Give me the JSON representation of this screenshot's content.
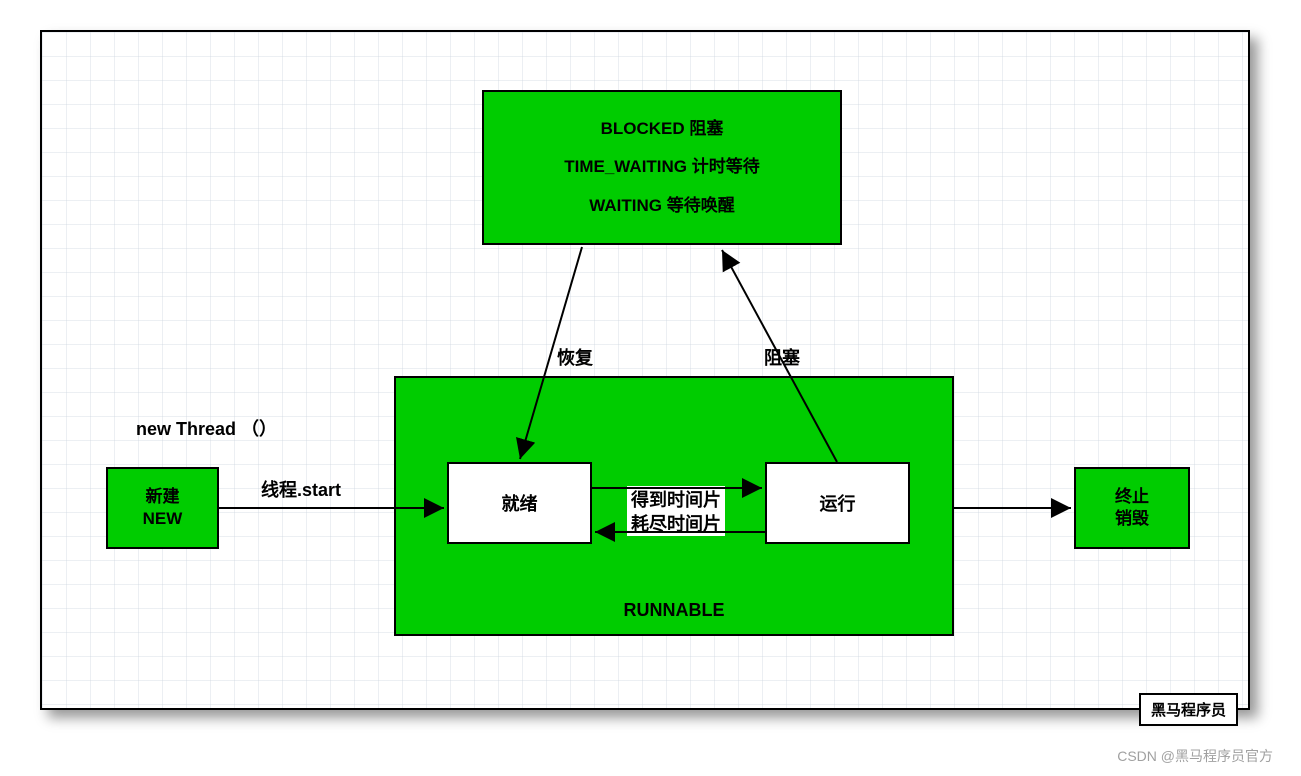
{
  "top_box": {
    "line1": "BLOCKED    阻塞",
    "line2": "TIME_WAITING   计时等待",
    "line3": "WAITING   等待唤醒"
  },
  "new_thread_label": "new Thread （）",
  "start_label": "线程.start",
  "resume_label": "恢复",
  "block_label": "阻塞",
  "mid_line1": "得到时间片",
  "mid_line2": "耗尽时间片",
  "new_box_line1": "新建",
  "new_box_line2": "NEW",
  "ready_box": "就绪",
  "run_box": "运行",
  "runnable_label": "RUNNABLE",
  "terminate_line1": "终止",
  "terminate_line2": "销毁",
  "watermark_box": "黑马程序员",
  "watermark_text": "CSDN @黑马程序员官方"
}
